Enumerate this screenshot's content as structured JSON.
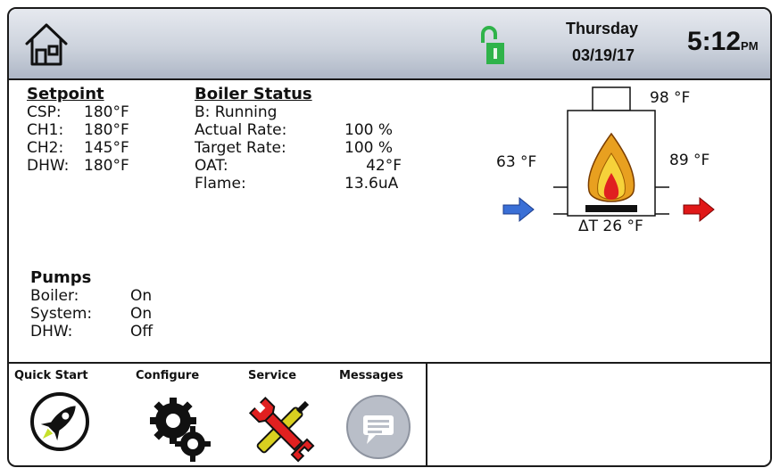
{
  "header": {
    "home_icon": "home-icon",
    "lock_icon": "unlock-icon",
    "day": "Thursday",
    "date": "03/19/17",
    "time": "5:12",
    "ampm": "PM"
  },
  "setpoint": {
    "title": "Setpoint",
    "rows": [
      {
        "label": "CSP:",
        "value": "180°F"
      },
      {
        "label": "CH1:",
        "value": "180°F"
      },
      {
        "label": "CH2:",
        "value": "145°F"
      },
      {
        "label": "DHW:",
        "value": "180°F"
      }
    ]
  },
  "boiler_status": {
    "title": "Boiler Status",
    "state": "B: Running",
    "rows": [
      {
        "label": "Actual Rate:",
        "value": "100 %"
      },
      {
        "label": "Target Rate:",
        "value": "100 %"
      },
      {
        "label": "OAT:",
        "value": "42°F"
      },
      {
        "label": "Flame:",
        "value": "13.6uA"
      }
    ]
  },
  "diagram": {
    "inlet_temp": "63 °F",
    "outlet_temp": "89 °F",
    "flue_temp": "98 °F",
    "delta_t": "ΔT 26 °F",
    "colors": {
      "inlet_arrow": "#3a6fd6",
      "outlet_arrow": "#e01818",
      "lock_green": "#2fb34a"
    }
  },
  "pumps": {
    "title": "Pumps",
    "rows": [
      {
        "label": "Boiler:",
        "value": "On"
      },
      {
        "label": "System:",
        "value": "On"
      },
      {
        "label": "DHW:",
        "value": "Off"
      }
    ]
  },
  "nav": {
    "items": [
      {
        "label": "Quick Start",
        "icon": "rocket-icon"
      },
      {
        "label": "Configure",
        "icon": "gears-icon"
      },
      {
        "label": "Service",
        "icon": "tools-icon"
      },
      {
        "label": "Messages",
        "icon": "message-icon"
      }
    ]
  }
}
